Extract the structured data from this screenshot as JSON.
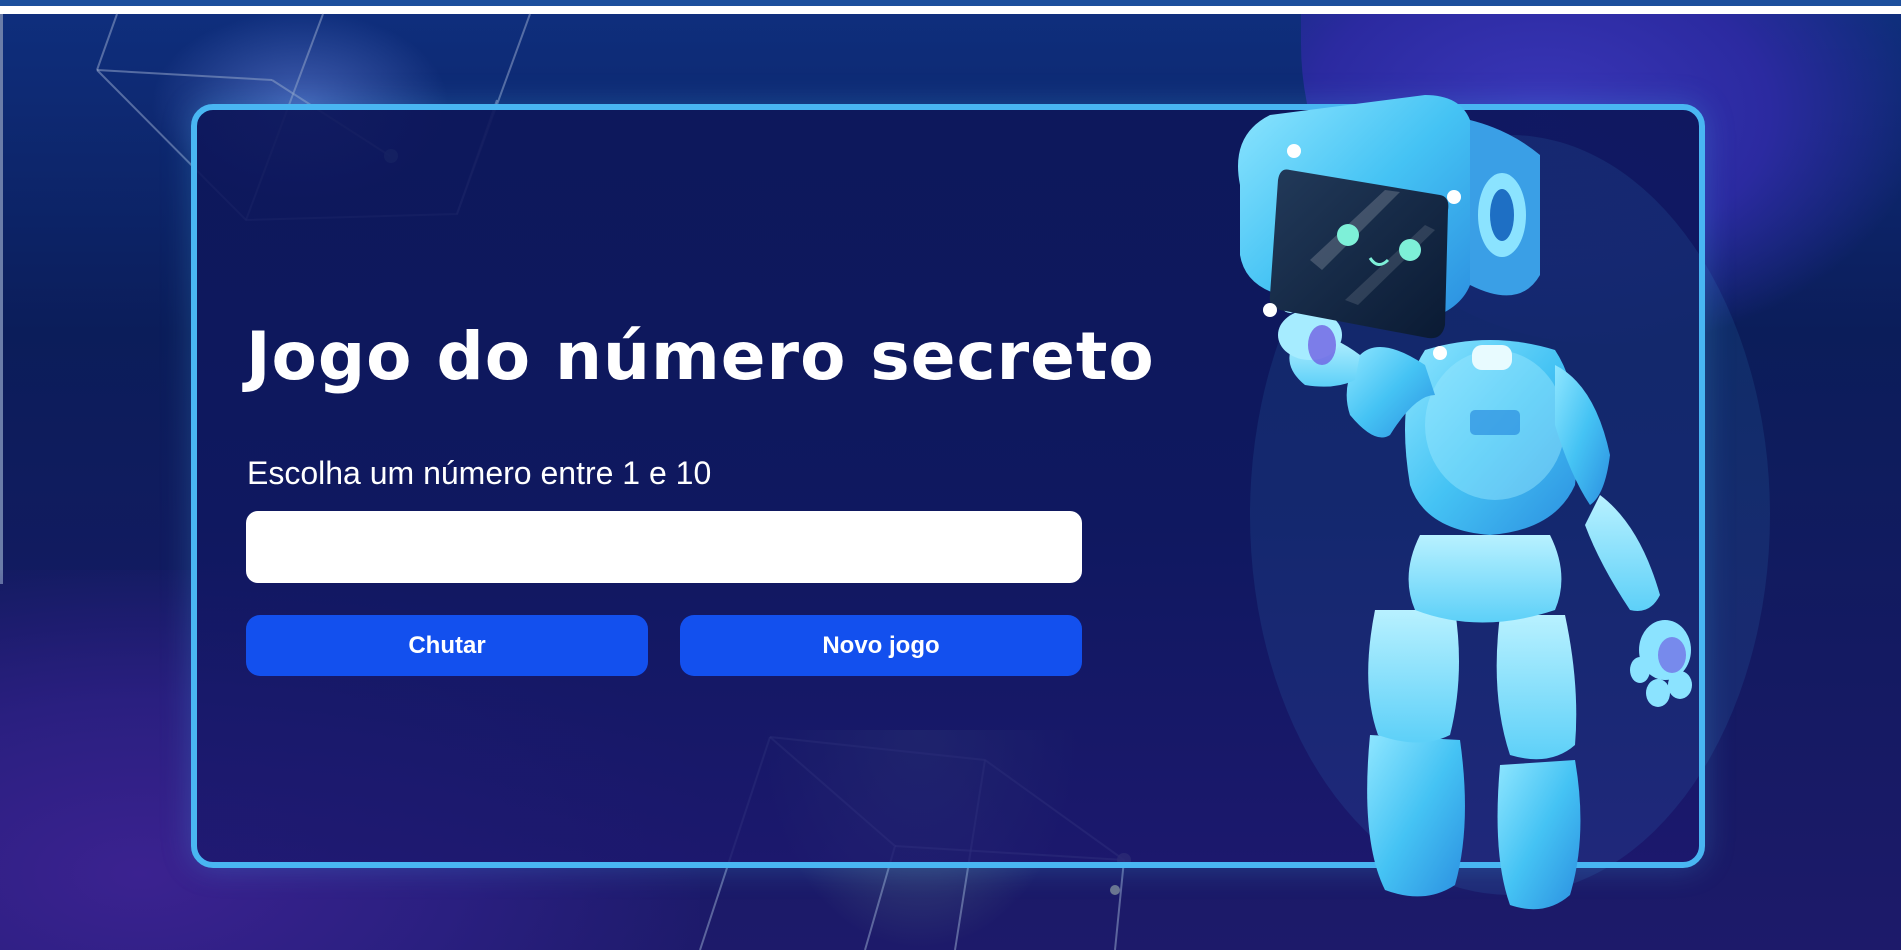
{
  "page": {
    "title": "Jogo do número secreto",
    "instruction": "Escolha um número entre 1 e 10"
  },
  "input": {
    "value": "",
    "placeholder": ""
  },
  "buttons": {
    "guess_label": "Chutar",
    "new_game_label": "Novo jogo"
  },
  "illustration": {
    "name": "robot-mascot"
  },
  "colors": {
    "accent": "#49b6f2",
    "button": "#1350ee",
    "background": "#0b1d5a"
  }
}
